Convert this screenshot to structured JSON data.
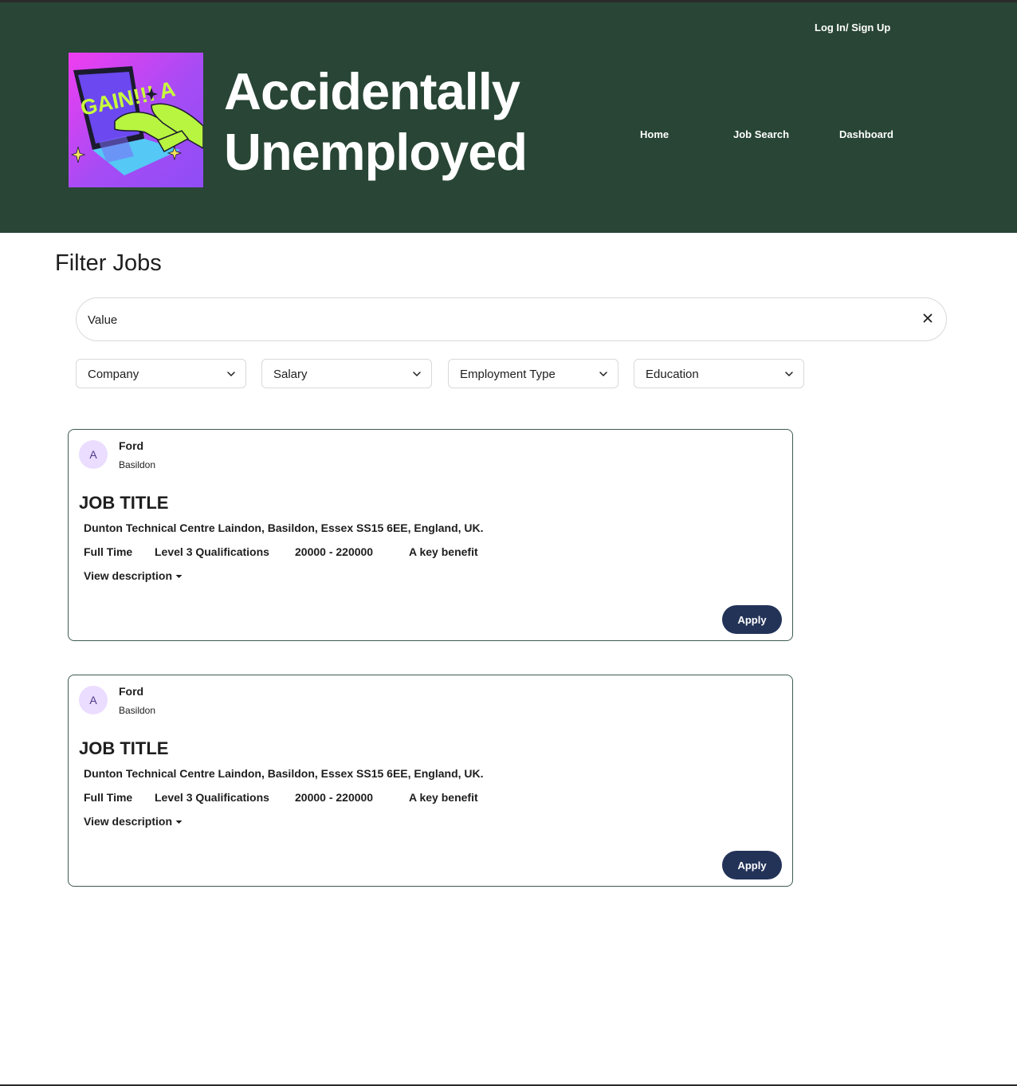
{
  "header": {
    "auth_link": "Log In/ Sign Up",
    "brand_line1": "Accidentally",
    "brand_line2": "Unemployed",
    "logo_text": "GAIN!!! A",
    "nav": [
      "Home",
      "Job Search",
      "Dashboard"
    ],
    "bg_color": "#284535"
  },
  "filters": {
    "title": "Filter Jobs",
    "search_value": "Value",
    "selects": [
      "Company",
      "Salary",
      "Employment Type",
      "Education"
    ]
  },
  "jobs": [
    {
      "avatar": "A",
      "company": "Ford",
      "location": "Basildon",
      "title": "JOB TITLE",
      "address": "Dunton Technical Centre Laindon, Basildon, Essex SS15 6EE, England, UK.",
      "type": "Full Time",
      "education": "Level 3 Qualifications",
      "salary": "20000 - 220000",
      "benefit": "A key benefit",
      "description_toggle": "View description",
      "apply_label": "Apply"
    },
    {
      "avatar": "A",
      "company": "Ford",
      "location": "Basildon",
      "title": "JOB TITLE",
      "address": "Dunton Technical Centre Laindon, Basildon, Essex SS15 6EE, England, UK.",
      "type": "Full Time",
      "education": "Level 3 Qualifications",
      "salary": "20000 - 220000",
      "benefit": "A key benefit",
      "description_toggle": "View description",
      "apply_label": "Apply"
    }
  ],
  "colors": {
    "header_bg": "#284535",
    "apply_button": "#233358",
    "card_border": "#3d5c4e",
    "avatar_bg": "#eaddff"
  }
}
